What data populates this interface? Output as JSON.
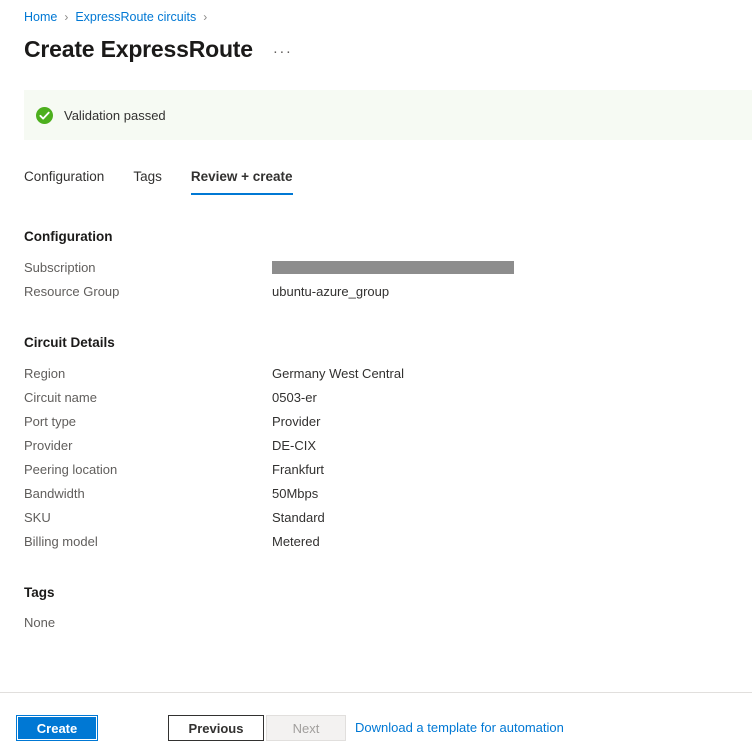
{
  "breadcrumb": {
    "items": [
      {
        "label": "Home"
      },
      {
        "label": "ExpressRoute circuits"
      }
    ],
    "separator": "›"
  },
  "header": {
    "title": "Create ExpressRoute",
    "more_menu": "···"
  },
  "banner": {
    "icon": "check-circle-icon",
    "text": "Validation passed",
    "background": "#f6faf3",
    "icon_color": "#4caf1d"
  },
  "tabs": [
    {
      "label": "Configuration",
      "active": false
    },
    {
      "label": "Tags",
      "active": false
    },
    {
      "label": "Review + create",
      "active": true
    }
  ],
  "sections": {
    "configuration": {
      "heading": "Configuration",
      "rows": [
        {
          "key": "Subscription",
          "value": "",
          "redacted": true
        },
        {
          "key": "Resource Group",
          "value": "ubuntu-azure_group",
          "redacted": false
        }
      ]
    },
    "circuit_details": {
      "heading": "Circuit Details",
      "rows": [
        {
          "key": "Region",
          "value": "Germany West Central"
        },
        {
          "key": "Circuit name",
          "value": "0503-er"
        },
        {
          "key": "Port type",
          "value": "Provider"
        },
        {
          "key": "Provider",
          "value": "DE-CIX"
        },
        {
          "key": "Peering location",
          "value": "Frankfurt"
        },
        {
          "key": "Bandwidth",
          "value": "50Mbps"
        },
        {
          "key": "SKU",
          "value": "Standard"
        },
        {
          "key": "Billing model",
          "value": "Metered"
        }
      ]
    },
    "tags": {
      "heading": "Tags",
      "value": "None"
    }
  },
  "footer": {
    "create_label": "Create",
    "previous_label": "Previous",
    "next_label": "Next",
    "template_link": "Download a template for automation",
    "accent_color": "#0078d4"
  }
}
